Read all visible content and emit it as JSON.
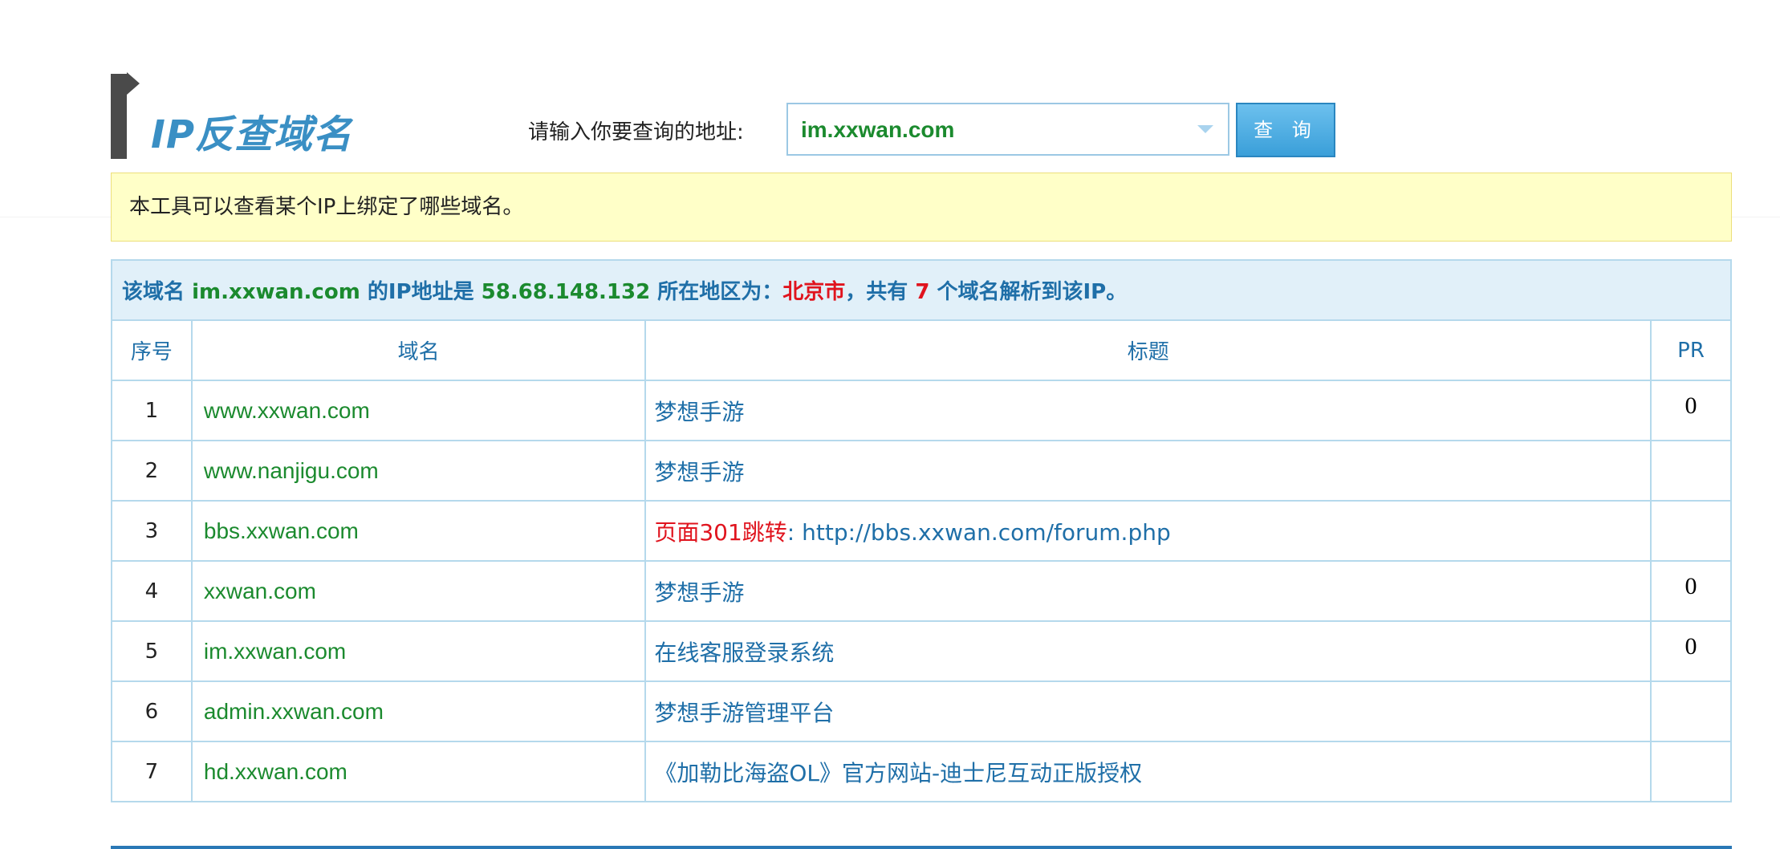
{
  "header": {
    "title": "IP反查域名",
    "search_label": "请输入你要查询的地址:",
    "search_value": "im.xxwan.com",
    "query_button": "查 询"
  },
  "notice": "本工具可以查看某个IP上绑定了哪些域名。",
  "summary": {
    "p1": "该域名 ",
    "domain": "im.xxwan.com",
    "p2": " 的IP地址是 ",
    "ip": "58.68.148.132",
    "p3": " 所在地区为：",
    "region": "北京市",
    "p4": "，共有 ",
    "count": "7",
    "p5": " 个域名解析到该IP。"
  },
  "table": {
    "headers": {
      "no": "序号",
      "domain": "域名",
      "title": "标题",
      "pr": "PR"
    },
    "rows": [
      {
        "no": "1",
        "domain": "www.xxwan.com",
        "title_prefix": "",
        "title": "梦想手游",
        "pr": "0"
      },
      {
        "no": "2",
        "domain": "www.nanjigu.com",
        "title_prefix": "",
        "title": "梦想手游",
        "pr": ""
      },
      {
        "no": "3",
        "domain": "bbs.xxwan.com",
        "title_prefix": "页面301跳转",
        "title": ": http://bbs.xxwan.com/forum.php",
        "pr": ""
      },
      {
        "no": "4",
        "domain": "xxwan.com",
        "title_prefix": "",
        "title": "梦想手游",
        "pr": "0"
      },
      {
        "no": "5",
        "domain": "im.xxwan.com",
        "title_prefix": "",
        "title": "在线客服登录系统",
        "pr": "0"
      },
      {
        "no": "6",
        "domain": "admin.xxwan.com",
        "title_prefix": "",
        "title": "梦想手游管理平台",
        "pr": ""
      },
      {
        "no": "7",
        "domain": "hd.xxwan.com",
        "title_prefix": "",
        "title": "《加勒比海盗OL》官方网站-迪士尼互动正版授权",
        "pr": ""
      }
    ]
  },
  "colors": {
    "accent_blue": "#1f6fa8",
    "domain_green": "#1b8a2e",
    "highlight_red": "#e0141e",
    "notice_bg": "#ffffc8",
    "summary_bg": "#e1f0f9"
  }
}
